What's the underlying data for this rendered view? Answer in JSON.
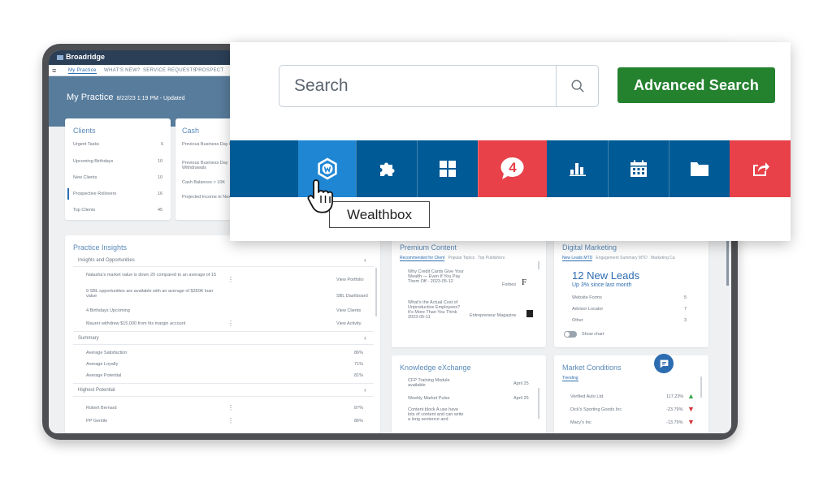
{
  "app": {
    "brand": "Broadridge",
    "nav": [
      "My Practice",
      "WHAT'S NEW?",
      "SERVICE REQUESTS",
      "PROSPECT"
    ],
    "page_title": "My Practice",
    "page_subtitle": "8/22/23 1:19 PM - Updated"
  },
  "clients_card": {
    "title": "Clients",
    "rows": [
      {
        "label": "Urgent Tasks",
        "value": "6"
      },
      {
        "label": "Upcoming Birthdays",
        "value": "10"
      },
      {
        "label": "New Clients",
        "value": "10"
      },
      {
        "label": "Prospective Rollovers",
        "value": "16"
      },
      {
        "label": "Top Clients",
        "value": "45"
      }
    ]
  },
  "cash_card": {
    "title": "Cash",
    "rows": [
      "Previous Business Day Deposits",
      "Previous Business Day Withdrawals",
      "Cash Balances > 10K",
      "Projected Income in Next week"
    ]
  },
  "practice_insights": {
    "title": "Practice Insights",
    "section1": "Insights and Opportunities",
    "rows1": [
      {
        "text": "Natasha's market value is down 20 compared to an average of 15",
        "action": "View Portfolio"
      },
      {
        "text": "9 SBL opportunities are available with an average of $350K loan value",
        "action": "SBL Dashboard"
      },
      {
        "text": "4 Birthdays Upcoming",
        "action": "View Clients"
      },
      {
        "text": "Maurer withdrew $15,000 from his margin account",
        "action": "View Activity"
      }
    ],
    "section2": "Summary",
    "rows2": [
      {
        "text": "Average Satisfaction",
        "action": "86%"
      },
      {
        "text": "Average Loyalty",
        "action": "71%"
      },
      {
        "text": "Average Potential",
        "action": "81%"
      }
    ],
    "section3": "Highest Potential",
    "rows3": [
      {
        "text": "Robert Bernard",
        "action": "87%"
      },
      {
        "text": "PP Gentile",
        "action": "86%"
      }
    ]
  },
  "premium_content": {
    "title": "Premium Content",
    "tabs": [
      "Recommended for Client",
      "Popular Topics",
      "Top Publishers"
    ],
    "items": [
      {
        "text": "Why Credit Cards Give Your Wealth — Even If You Pay Them Off · 2023-05-12",
        "source": "Forbes"
      },
      {
        "text": "What's the Actual Cost of Unproductive Employees? It's More Than You Think 2023-05-11",
        "source": "Entrepreneur Magazine"
      }
    ]
  },
  "digital_marketing": {
    "title": "Digital Marketing",
    "tabs": [
      "New Leads MTD",
      "Engagement Summary MTD",
      "Marketing Ca"
    ],
    "headline": "12 New Leads",
    "sub": "Up 3% since last month",
    "rows": [
      {
        "label": "Website Forms",
        "value": "5"
      },
      {
        "label": "Advisor Locator",
        "value": "7"
      },
      {
        "label": "Other",
        "value": "3"
      }
    ],
    "toggle": "Show chart"
  },
  "knowledge_exchange": {
    "title": "Knowledge eXchange",
    "rows": [
      {
        "text": "CFP Training Module available",
        "date": "April 25"
      },
      {
        "text": "Weekly Market Pulse",
        "date": "April 25"
      },
      {
        "text": "Content block A use have lots of content and can write a long sentence and",
        "date": ""
      }
    ]
  },
  "market_conditions": {
    "title": "Market Conditions",
    "tab": "Trending",
    "rows": [
      {
        "name": "Verified Auto Ltd.",
        "change": "117.23%",
        "dir": "up"
      },
      {
        "name": "Dick's Sporting Goods Inc",
        "change": "-23.79%",
        "dir": "down"
      },
      {
        "name": "Macy's Inc",
        "change": "-13.79%",
        "dir": "down"
      }
    ],
    "up_color": "#3aa64a",
    "down_color": "#d6323b"
  },
  "zoom": {
    "search_placeholder": "Search",
    "advanced_search": "Advanced Search",
    "tooltip": "Wealthbox",
    "notification_count": "4",
    "tools": [
      {
        "icon": "blank",
        "bg": "#005a95"
      },
      {
        "icon": "wealthbox-icon",
        "bg": "#1f86d4"
      },
      {
        "icon": "puzzle-icon",
        "bg": "#005a95"
      },
      {
        "icon": "grid-icon",
        "bg": "#005a95"
      },
      {
        "icon": "chat-notification-icon",
        "bg": "#e84149"
      },
      {
        "icon": "bar-chart-icon",
        "bg": "#005a95"
      },
      {
        "icon": "calendar-icon",
        "bg": "#005a95"
      },
      {
        "icon": "folder-icon",
        "bg": "#005a95"
      },
      {
        "icon": "share-icon",
        "bg": "#e84149"
      }
    ]
  }
}
